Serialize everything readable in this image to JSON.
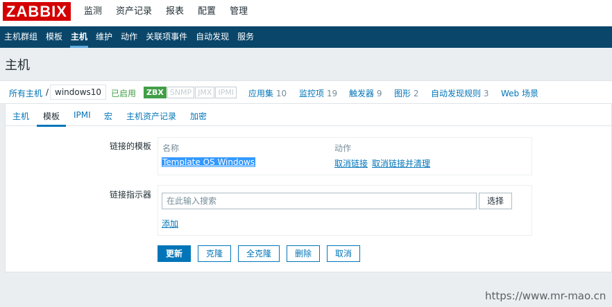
{
  "logo": "ZABBIX",
  "top_menu": [
    "监测",
    "资产记录",
    "报表",
    "配置",
    "管理"
  ],
  "sub_menu": [
    "主机群组",
    "模板",
    "主机",
    "维护",
    "动作",
    "关联项事件",
    "自动发现",
    "服务"
  ],
  "page_title": "主机",
  "host_nav": {
    "all_hosts": "所有主机",
    "separator": "/",
    "host_name": "windows10",
    "status": "已启用",
    "availability": [
      "ZBX",
      "SNMP",
      "JMX",
      "IPMI"
    ],
    "apps": {
      "label": "应用集",
      "count": "10"
    },
    "items": {
      "label": "监控项",
      "count": "19"
    },
    "triggers": {
      "label": "触发器",
      "count": "9"
    },
    "graphs": {
      "label": "图形",
      "count": "2"
    },
    "discovery": {
      "label": "自动发现规则",
      "count": "3"
    },
    "web": "Web 场景"
  },
  "tabs": [
    "主机",
    "模板",
    "IPMI",
    "宏",
    "主机资产记录",
    "加密"
  ],
  "form": {
    "linked_templates_label": "链接的模板",
    "col_name": "名称",
    "col_action": "动作",
    "template_name": "Template OS Windows",
    "unlink": "取消链接",
    "unlink_clear": "取消链接并清理",
    "link_new_label": "链接指示器",
    "search_placeholder": "在此输入搜索",
    "select_button": "选择",
    "add_link": "添加"
  },
  "buttons": {
    "update": "更新",
    "clone": "克隆",
    "full_clone": "全克隆",
    "delete": "删除",
    "cancel": "取消"
  },
  "watermark": "https://www.mr-mao.cn",
  "colors": {
    "logo_red": "#d40000",
    "nav_blue": "#0a466a",
    "link_blue": "#0275b8",
    "status_green": "#429e47"
  }
}
